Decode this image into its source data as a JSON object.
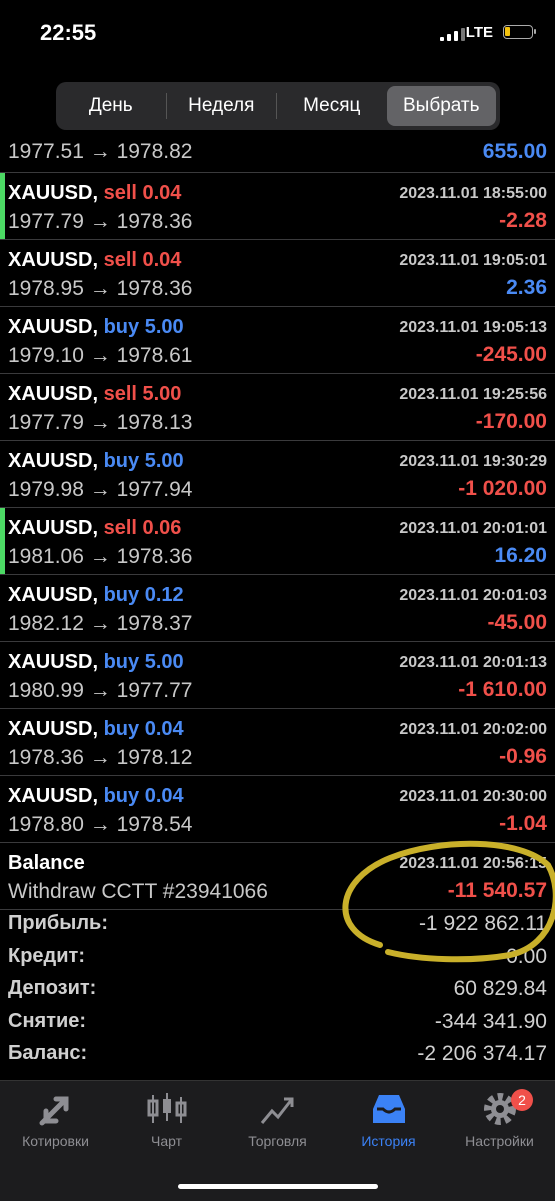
{
  "status_bar": {
    "time": "22:55",
    "network": "LTE"
  },
  "period_tabs": [
    {
      "label": "День",
      "selected": false
    },
    {
      "label": "Неделя",
      "selected": false
    },
    {
      "label": "Месяц",
      "selected": false
    },
    {
      "label": "Выбрать",
      "selected": true
    }
  ],
  "partial_row": {
    "prices": "1977.51 → 1978.82",
    "profit": "655.00",
    "profit_sign": "pos"
  },
  "trades": [
    {
      "symbol": "XAUUSD,",
      "side": "sell",
      "volume": "0.04",
      "date": "2023.11.01 18:55:00",
      "prices": "1977.79 → 1978.36",
      "profit": "-2.28",
      "profit_sign": "neg",
      "marker": true
    },
    {
      "symbol": "XAUUSD,",
      "side": "sell",
      "volume": "0.04",
      "date": "2023.11.01 19:05:01",
      "prices": "1978.95 → 1978.36",
      "profit": "2.36",
      "profit_sign": "pos",
      "marker": false
    },
    {
      "symbol": "XAUUSD,",
      "side": "buy",
      "volume": "5.00",
      "date": "2023.11.01 19:05:13",
      "prices": "1979.10 → 1978.61",
      "profit": "-245.00",
      "profit_sign": "neg",
      "marker": false
    },
    {
      "symbol": "XAUUSD,",
      "side": "sell",
      "volume": "5.00",
      "date": "2023.11.01 19:25:56",
      "prices": "1977.79 → 1978.13",
      "profit": "-170.00",
      "profit_sign": "neg",
      "marker": false
    },
    {
      "symbol": "XAUUSD,",
      "side": "buy",
      "volume": "5.00",
      "date": "2023.11.01 19:30:29",
      "prices": "1979.98 → 1977.94",
      "profit": "-1 020.00",
      "profit_sign": "neg",
      "marker": false
    },
    {
      "symbol": "XAUUSD,",
      "side": "sell",
      "volume": "0.06",
      "date": "2023.11.01 20:01:01",
      "prices": "1981.06 → 1978.36",
      "profit": "16.20",
      "profit_sign": "pos",
      "marker": true
    },
    {
      "symbol": "XAUUSD,",
      "side": "buy",
      "volume": "0.12",
      "date": "2023.11.01 20:01:03",
      "prices": "1982.12 → 1978.37",
      "profit": "-45.00",
      "profit_sign": "neg",
      "marker": false
    },
    {
      "symbol": "XAUUSD,",
      "side": "buy",
      "volume": "5.00",
      "date": "2023.11.01 20:01:13",
      "prices": "1980.99 → 1977.77",
      "profit": "-1 610.00",
      "profit_sign": "neg",
      "marker": false
    },
    {
      "symbol": "XAUUSD,",
      "side": "buy",
      "volume": "0.04",
      "date": "2023.11.01 20:02:00",
      "prices": "1978.36 → 1978.12",
      "profit": "-0.96",
      "profit_sign": "neg",
      "marker": false
    },
    {
      "symbol": "XAUUSD,",
      "side": "buy",
      "volume": "0.04",
      "date": "2023.11.01 20:30:00",
      "prices": "1978.80 → 1978.54",
      "profit": "-1.04",
      "profit_sign": "neg",
      "marker": false
    }
  ],
  "balance_row": {
    "title": "Balance",
    "date": "2023.11.01 20:56:15",
    "comment": "Withdraw CCTT #23941066",
    "amount": "-11 540.57"
  },
  "summary": [
    {
      "label": "Прибыль:",
      "value": "-1 922 862.11"
    },
    {
      "label": "Кредит:",
      "value": "0.00"
    },
    {
      "label": "Депозит:",
      "value": "60 829.84"
    },
    {
      "label": "Снятие:",
      "value": "-344 341.90"
    },
    {
      "label": "Баланс:",
      "value": "-2 206 374.17"
    }
  ],
  "tabbar": [
    {
      "label": "Котировки",
      "icon": "quotes-arrows-icon",
      "active": false
    },
    {
      "label": "Чарт",
      "icon": "candlestick-chart-icon",
      "active": false
    },
    {
      "label": "Торговля",
      "icon": "trade-chart-icon",
      "active": false
    },
    {
      "label": "История",
      "icon": "history-inbox-icon",
      "active": true
    },
    {
      "label": "Настройки",
      "icon": "gear-icon",
      "active": false,
      "badge": "2"
    }
  ],
  "colors": {
    "buy": "#4a8af4",
    "sell": "#f0504a",
    "positive": "#4a8af4",
    "negative": "#f0504a",
    "marker": "#4cd964",
    "active_tab": "#3b82f6",
    "annotation": "#c9b02a"
  }
}
